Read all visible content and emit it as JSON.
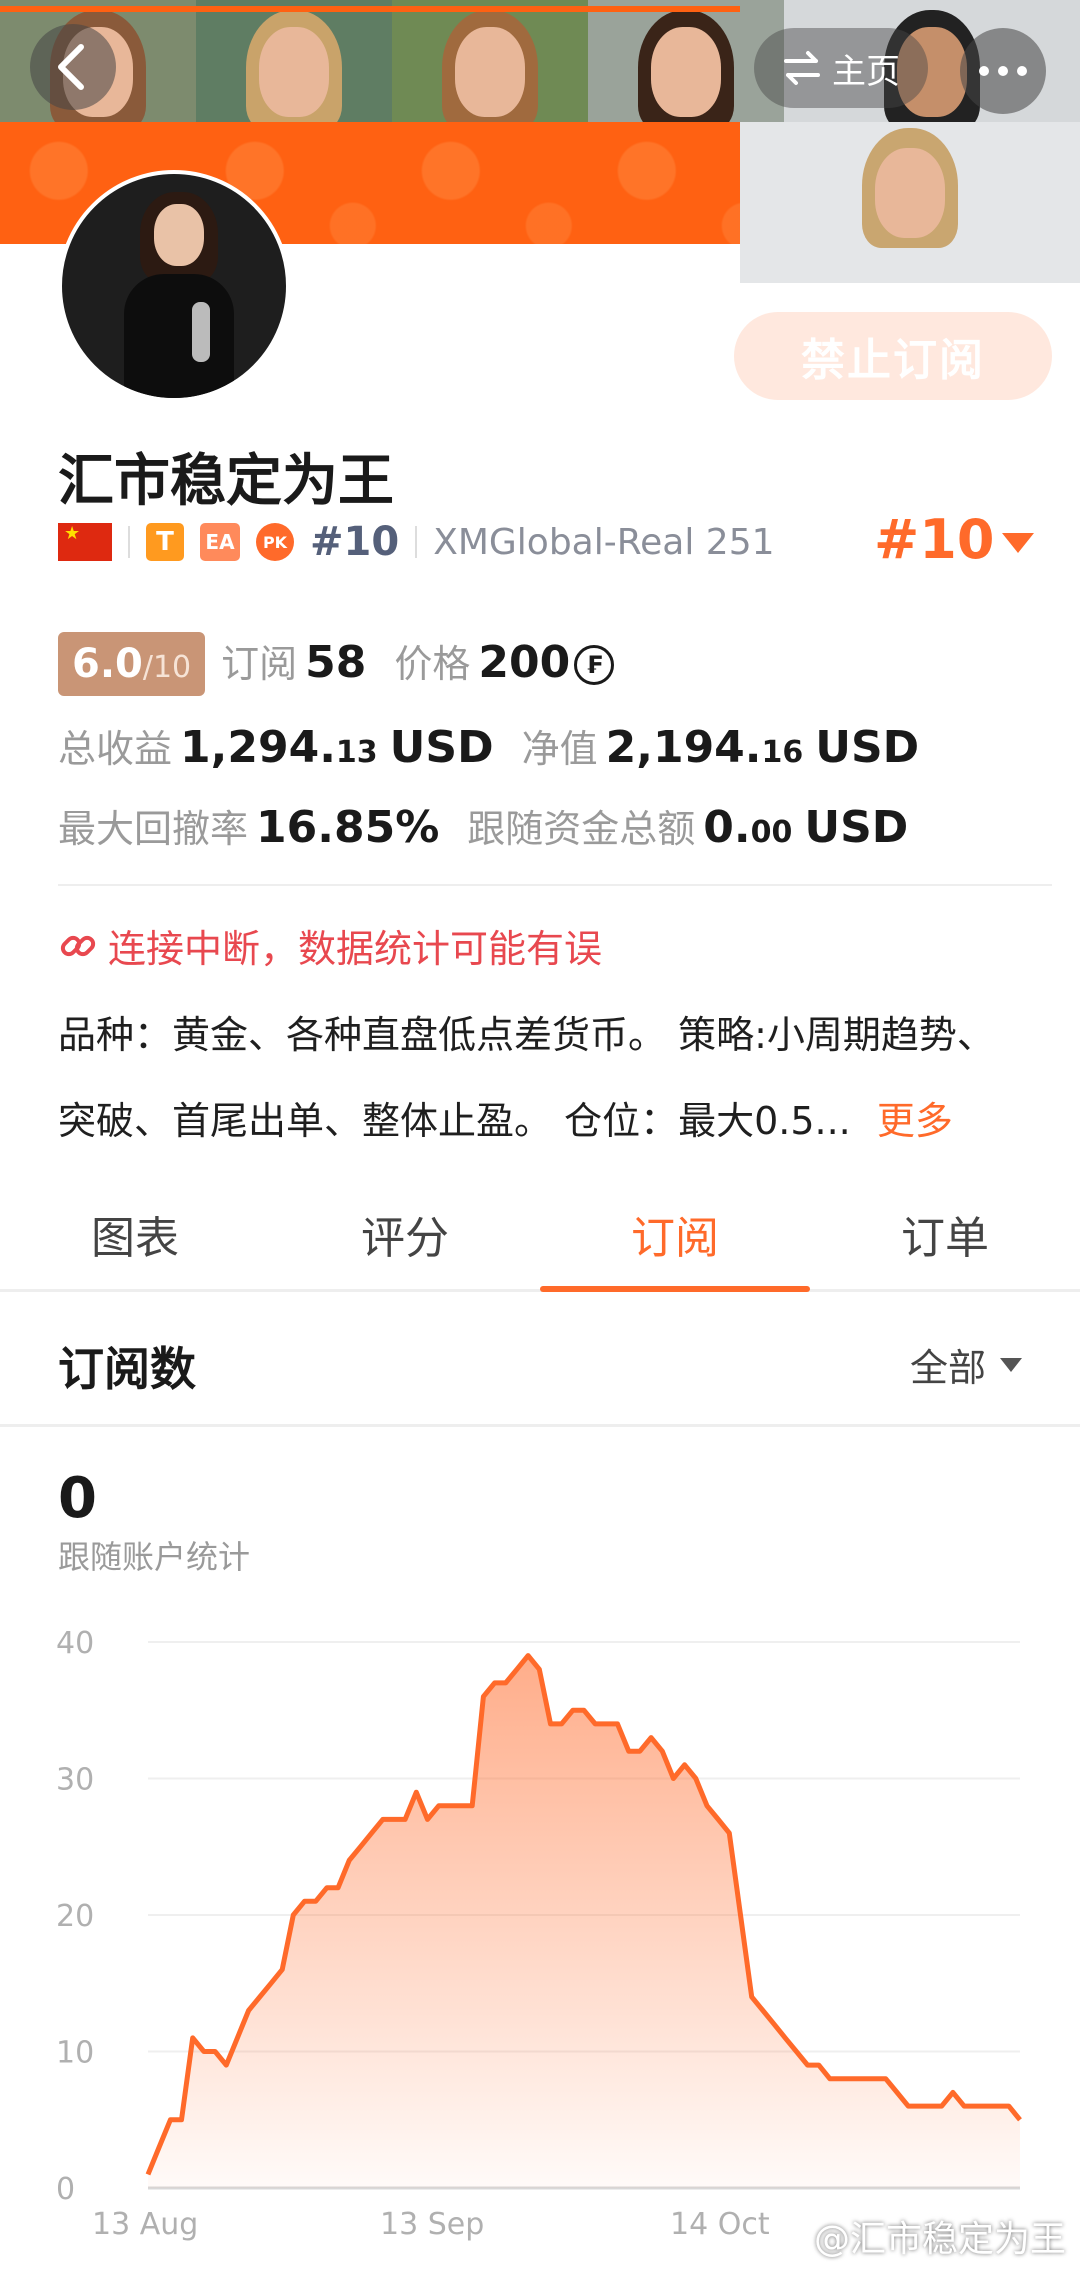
{
  "header": {
    "home_label": "主页",
    "back_icon": "back-arrow-icon",
    "more_icon": "more-dots-icon",
    "switch_icon": "switch-arrows-icon"
  },
  "profile": {
    "name": "汇市稳定为王",
    "subscribe_button": "禁止订阅",
    "badges": {
      "t": "T",
      "ea": "EA",
      "pk": "PK"
    },
    "rank_small": "#10",
    "broker_account": "XMGlobal-Real 251",
    "rank_big": "#10"
  },
  "stats": {
    "score_value": "6.0",
    "score_max": "/10",
    "subscriptions_label": "订阅",
    "subscriptions_value": "58",
    "price_label": "价格",
    "price_value": "200",
    "total_profit_label": "总收益",
    "total_profit_int": "1,294.",
    "total_profit_dec": "13",
    "total_profit_unit": "USD",
    "equity_label": "净值",
    "equity_int": "2,194.",
    "equity_dec": "16",
    "equity_unit": "USD",
    "max_drawdown_label": "最大回撤率",
    "max_drawdown_value": "16.85%",
    "follow_funds_label": "跟随资金总额",
    "follow_funds_int": "0.",
    "follow_funds_dec": "00",
    "follow_funds_unit": "USD"
  },
  "warning": "连接中断，数据统计可能有误",
  "description": {
    "line1": "品种：黄金、各种直盘低点差货币。 策略:小周期趋势、",
    "line2": "突破、首尾出单、整体止盈。 仓位：最大0.5...",
    "more": "更多"
  },
  "tabs": [
    "图表",
    "评分",
    "订阅",
    "订单"
  ],
  "active_tab": 2,
  "section": {
    "title": "订阅数",
    "filter": "全部",
    "count": "0",
    "count_label": "跟随账户统计"
  },
  "chart_data": {
    "type": "area",
    "x_tick_labels": [
      "13 Aug",
      "13 Sep",
      "14 Oct"
    ],
    "ylim": [
      0,
      40
    ],
    "y_ticks": [
      0,
      10,
      20,
      30,
      40
    ],
    "grid": true,
    "color": "#ff6a2a",
    "series": [
      {
        "values": [
          1,
          3,
          5,
          5,
          11,
          10,
          10,
          9,
          11,
          13,
          14,
          15,
          16,
          20,
          21,
          21,
          22,
          22,
          24,
          25,
          26,
          27,
          27,
          27,
          29,
          27,
          28,
          28,
          28,
          28,
          36,
          37,
          37,
          38,
          39,
          38,
          34,
          34,
          35,
          35,
          34,
          34,
          34,
          32,
          32,
          33,
          32,
          30,
          31,
          30,
          28,
          27,
          26,
          20,
          14,
          13,
          12,
          11,
          10,
          9,
          9,
          8,
          8,
          8,
          8,
          8,
          8,
          7,
          6,
          6,
          6,
          6,
          7,
          6,
          6,
          6,
          6,
          6,
          5
        ]
      }
    ]
  },
  "watermark": "@汇市稳定为王"
}
